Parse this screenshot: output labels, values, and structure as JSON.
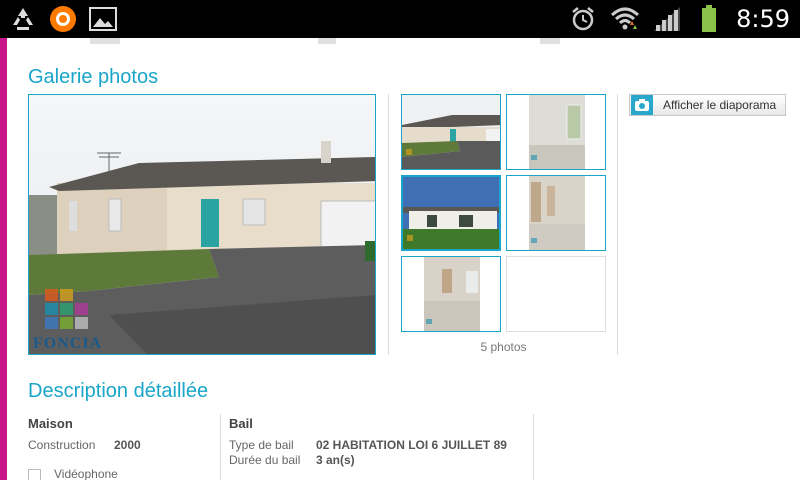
{
  "status_bar": {
    "time": "8:59",
    "left_icons": [
      "recycle-icon",
      "orange-app-icon",
      "gallery-icon"
    ],
    "right_icons": [
      "alarm-icon",
      "wifi-icon",
      "signal-icon",
      "battery-icon"
    ]
  },
  "gallery": {
    "title": "Galerie photos",
    "photo_count": "5 photos",
    "slideshow_label": "Afficher le diaporama",
    "watermark": "FONCIA"
  },
  "description": {
    "title": "Description détaillée",
    "maison": {
      "heading": "Maison",
      "construction_label": "Construction",
      "construction_value": "2000",
      "videophone_label": "Vidéophone"
    },
    "bail": {
      "heading": "Bail",
      "type_label": "Type de bail",
      "type_value": "02 HABITATION LOI 6 JUILLET 89",
      "duree_label": "Durée du bail",
      "duree_value": "3 an(s)"
    }
  },
  "colors": {
    "accent": "#1aa6c9",
    "side_bar": "#c8168a"
  }
}
